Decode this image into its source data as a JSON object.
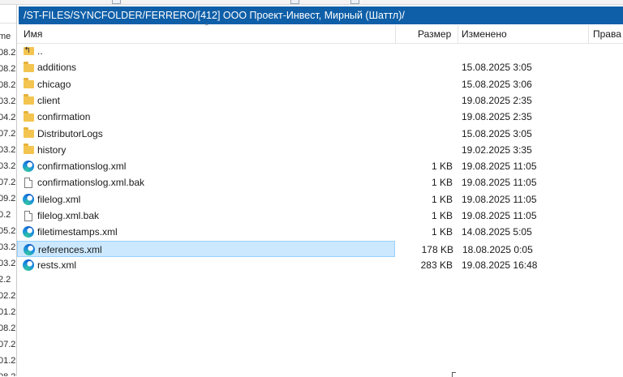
{
  "left_panel": {
    "header_fragment": "me",
    "date_fragments": [
      "08.2",
      "08.2",
      "08.2",
      "03.2",
      "04.2",
      "07.2",
      "03.2",
      "03.2",
      "07.2",
      "09.2",
      "0.2",
      "05.2",
      "03.2",
      "03.2",
      "2.2",
      "02.2",
      "01.2",
      "08.2",
      "07.2",
      "01.2",
      "08.2"
    ]
  },
  "right_panel": {
    "path": "/ST-FILES/SYNCFOLDER/FERRERO/[412] ООО Проект-Инвест, Мирный (Шаттл)/",
    "columns": {
      "name": "Имя",
      "size": "Размер",
      "modified": "Изменено",
      "rights": "Права"
    },
    "files": [
      {
        "icon": "up-folder-icon",
        "name": "..",
        "size": "",
        "modified": ""
      },
      {
        "icon": "folder-icon",
        "name": "additions",
        "size": "",
        "modified": "15.08.2025 3:05"
      },
      {
        "icon": "folder-icon",
        "name": "chicago",
        "size": "",
        "modified": "15.08.2025 3:06"
      },
      {
        "icon": "folder-icon",
        "name": "client",
        "size": "",
        "modified": "19.08.2025 2:35"
      },
      {
        "icon": "folder-icon",
        "name": "confirmation",
        "size": "",
        "modified": "19.08.2025 2:35"
      },
      {
        "icon": "folder-icon",
        "name": "DistributorLogs",
        "size": "",
        "modified": "15.08.2025 3:05"
      },
      {
        "icon": "folder-icon",
        "name": "history",
        "size": "",
        "modified": "19.02.2025 3:35"
      },
      {
        "icon": "edge-xml-icon",
        "name": "confirmationslog.xml",
        "size": "1 KB",
        "modified": "19.08.2025 11:05"
      },
      {
        "icon": "file-icon",
        "name": "confirmationslog.xml.bak",
        "size": "1 KB",
        "modified": "19.08.2025 11:05"
      },
      {
        "icon": "edge-xml-icon",
        "name": "filelog.xml",
        "size": "1 KB",
        "modified": "19.08.2025 11:05"
      },
      {
        "icon": "file-icon",
        "name": "filelog.xml.bak",
        "size": "1 KB",
        "modified": "19.08.2025 11:05"
      },
      {
        "icon": "edge-xml-icon",
        "name": "filetimestamps.xml",
        "size": "1 KB",
        "modified": "14.08.2025 5:05"
      },
      {
        "icon": "edge-xml-icon",
        "name": "references.xml",
        "size": "178 KB",
        "modified": "18.08.2025 0:05",
        "selected": true
      },
      {
        "icon": "edge-xml-icon",
        "name": "rests.xml",
        "size": "283 KB",
        "modified": "19.08.2025 16:48"
      }
    ]
  },
  "colors": {
    "path_bar": "#0f5fa8",
    "selection": "#cce8ff",
    "folder": "#f3c44f"
  }
}
